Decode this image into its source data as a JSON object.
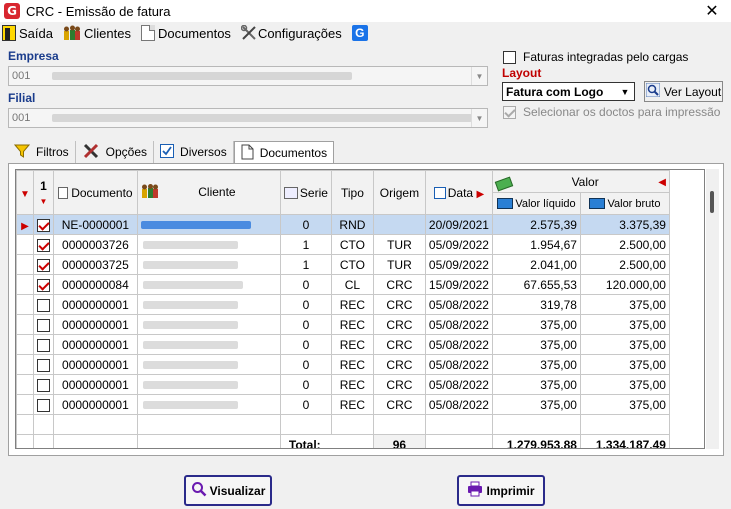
{
  "window": {
    "title": "CRC - Emissão de fatura",
    "app_icon_letter": "G"
  },
  "menu": {
    "items": [
      {
        "name": "menu-saida",
        "label": "Saída"
      },
      {
        "name": "menu-clientes",
        "label": "Clientes"
      },
      {
        "name": "menu-documentos",
        "label": "Documentos"
      },
      {
        "name": "menu-configuracoes",
        "label": "Configurações"
      }
    ],
    "g_icon_letter": "G"
  },
  "form": {
    "empresa_label": "Empresa",
    "empresa_code": "001",
    "filial_label": "Filial",
    "filial_code": "001",
    "faturas_integradas_label": "Faturas integradas pelo cargas",
    "layout_label": "Layout",
    "layout_value": "Fatura com Logo",
    "ver_layout_label": "Ver Layout",
    "selecionar_label": "Selecionar os doctos para impressão"
  },
  "tabs": [
    {
      "name": "tab-filtros",
      "label": "Filtros"
    },
    {
      "name": "tab-opcoes",
      "label": "Opções"
    },
    {
      "name": "tab-diversos",
      "label": "Diversos"
    },
    {
      "name": "tab-documentos",
      "label": "Documentos"
    }
  ],
  "grid": {
    "headers": {
      "sort_number": "1",
      "documento": "Documento",
      "cliente": "Cliente",
      "serie": "Serie",
      "tipo": "Tipo",
      "origem": "Origem",
      "data": "Data",
      "valor": "Valor",
      "valor_liquido": "Valor líquido",
      "valor_bruto": "Valor bruto"
    },
    "rows": [
      {
        "checked": true,
        "documento": "NE-0000001",
        "serie": "0",
        "tipo": "RND",
        "origem": "",
        "data": "20/09/2021",
        "valor_liquido": "2.575,39",
        "valor_bruto": "3.375,39",
        "selected": true
      },
      {
        "checked": true,
        "documento": "0000003726",
        "serie": "1",
        "tipo": "CTO",
        "origem": "TUR",
        "data": "05/09/2022",
        "valor_liquido": "1.954,67",
        "valor_bruto": "2.500,00"
      },
      {
        "checked": true,
        "documento": "0000003725",
        "serie": "1",
        "tipo": "CTO",
        "origem": "TUR",
        "data": "05/09/2022",
        "valor_liquido": "2.041,00",
        "valor_bruto": "2.500,00"
      },
      {
        "checked": true,
        "documento": "0000000084",
        "serie": "0",
        "tipo": "CL",
        "origem": "CRC",
        "data": "15/09/2022",
        "valor_liquido": "67.655,53",
        "valor_bruto": "120.000,00"
      },
      {
        "checked": false,
        "documento": "0000000001",
        "serie": "0",
        "tipo": "REC",
        "origem": "CRC",
        "data": "05/08/2022",
        "valor_liquido": "319,78",
        "valor_bruto": "375,00"
      },
      {
        "checked": false,
        "documento": "0000000001",
        "serie": "0",
        "tipo": "REC",
        "origem": "CRC",
        "data": "05/08/2022",
        "valor_liquido": "375,00",
        "valor_bruto": "375,00"
      },
      {
        "checked": false,
        "documento": "0000000001",
        "serie": "0",
        "tipo": "REC",
        "origem": "CRC",
        "data": "05/08/2022",
        "valor_liquido": "375,00",
        "valor_bruto": "375,00"
      },
      {
        "checked": false,
        "documento": "0000000001",
        "serie": "0",
        "tipo": "REC",
        "origem": "CRC",
        "data": "05/08/2022",
        "valor_liquido": "375,00",
        "valor_bruto": "375,00"
      },
      {
        "checked": false,
        "documento": "0000000001",
        "serie": "0",
        "tipo": "REC",
        "origem": "CRC",
        "data": "05/08/2022",
        "valor_liquido": "375,00",
        "valor_bruto": "375,00"
      },
      {
        "checked": false,
        "documento": "0000000001",
        "serie": "0",
        "tipo": "REC",
        "origem": "CRC",
        "data": "05/08/2022",
        "valor_liquido": "375,00",
        "valor_bruto": "375,00"
      }
    ],
    "totals": {
      "label": "Total:",
      "count": "96",
      "valor_liquido": "1.279.953,88",
      "valor_bruto": "1.334.187,49"
    }
  },
  "buttons": {
    "visualizar": "Visualizar",
    "imprimir": "Imprimir"
  },
  "colors": {
    "label_blue": "#1a3c8c",
    "layout_red": "#c00000",
    "selection": "#c5d9f1",
    "button_border": "#2a2a8a"
  }
}
